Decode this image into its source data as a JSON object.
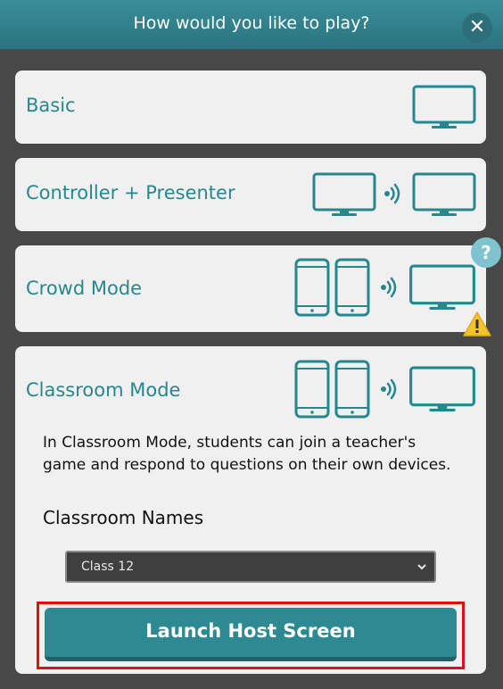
{
  "header": {
    "title": "How would you like to play?"
  },
  "modes": [
    {
      "label": "Basic"
    },
    {
      "label": "Controller + Presenter"
    },
    {
      "label": "Crowd Mode"
    },
    {
      "label": "Classroom Mode"
    }
  ],
  "classroom": {
    "description": "In Classroom Mode, students can join a teacher's game and respond to questions on their own devices.",
    "names_label": "Classroom Names",
    "selected_class": "Class 12",
    "launch_label": "Launch Host Screen"
  },
  "badges": {
    "help": "?"
  },
  "colors": {
    "accent": "#27878f",
    "header": "#2f7f8a",
    "button": "#2d8a92",
    "highlight": "#e01010"
  },
  "icons": [
    "close-icon",
    "monitor-icon",
    "wireless-signal-icon",
    "phone-icon",
    "help-icon",
    "warning-icon",
    "chevron-down-icon"
  ]
}
